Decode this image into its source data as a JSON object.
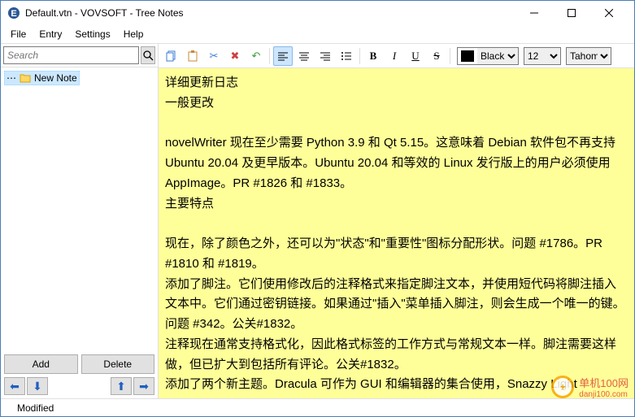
{
  "window": {
    "title": "Default.vtn - VOVSOFT - Tree Notes"
  },
  "menu": {
    "file": "File",
    "entry": "Entry",
    "settings": "Settings",
    "help": "Help"
  },
  "search": {
    "placeholder": "Search"
  },
  "tree": {
    "item0": "New Note"
  },
  "buttons": {
    "add": "Add",
    "delete": "Delete"
  },
  "toolbar": {
    "color_label": "Black",
    "font_size": "12",
    "font_name": "Tahoma"
  },
  "editor": {
    "content": "详细更新日志\n一般更改\n\nnovelWriter 现在至少需要 Python 3.9 和 Qt 5.15。这意味着 Debian 软件包不再支持 Ubuntu 20.04 及更早版本。Ubuntu 20.04 和等效的 Linux 发行版上的用户必须使用 AppImage。PR #1826 和 #1833。\n主要特点\n\n现在，除了颜色之外，还可以为\"状态\"和\"重要性\"图标分配形状。问题 #1786。PR #1810 和 #1819。\n添加了脚注。它们使用修改后的注释格式来指定脚注文本，并使用短代码将脚注插入文本中。它们通过密钥链接。如果通过\"插入\"菜单插入脚注，则会生成一个唯一的键。问题 #342。公关#1832。\n注释现在通常支持格式化，因此格式标签的工作方式与常规文本一样。脚注需要这样做，但已扩大到包括所有评论。公关#1832。\n添加了两个新主题。Dracula 可作为 GUI 和编辑器的集合使用，Snazzy Light"
  },
  "status": {
    "modified": "Modified"
  },
  "watermark": {
    "plus": "+",
    "site": "danji100.com",
    "brand": "单机100网"
  }
}
